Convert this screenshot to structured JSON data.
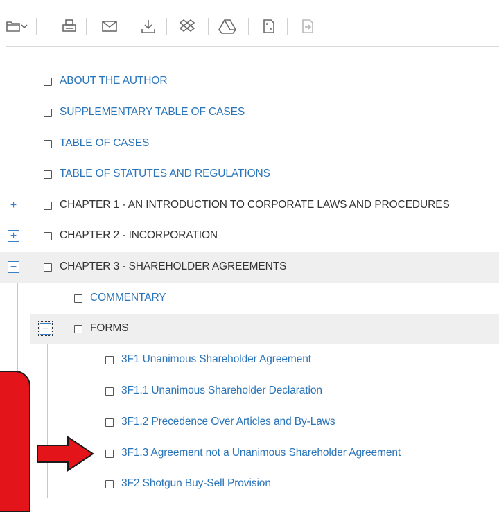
{
  "toolbar": {
    "icons": [
      "folder-icon",
      "chevron-down-icon",
      "print-icon",
      "email-icon",
      "download-icon",
      "dropbox-icon",
      "google-drive-icon",
      "save-document-icon",
      "export-icon"
    ]
  },
  "tree": {
    "items": [
      {
        "label": "ABOUT THE AUTHOR",
        "style": "link"
      },
      {
        "label": "SUPPLEMENTARY TABLE OF CASES",
        "style": "link"
      },
      {
        "label": "TABLE OF CASES",
        "style": "link"
      },
      {
        "label": "TABLE OF STATUTES AND REGULATIONS",
        "style": "link"
      },
      {
        "label": "CHAPTER 1 - AN INTRODUCTION TO CORPORATE LAWS AND PROCEDURES",
        "style": "plain",
        "toggle": "+"
      },
      {
        "label": "CHAPTER 2 - INCORPORATION",
        "style": "plain",
        "toggle": "+"
      },
      {
        "label": "CHAPTER 3 - SHAREHOLDER AGREEMENTS",
        "style": "plain",
        "toggle": "−"
      },
      {
        "label": "COMMENTARY",
        "style": "link"
      },
      {
        "label": "FORMS",
        "style": "plain",
        "toggle": "−"
      },
      {
        "label": "3F1 Unanimous Shareholder Agreement",
        "style": "link"
      },
      {
        "label": "3F1.1 Unanimous Shareholder Declaration",
        "style": "link"
      },
      {
        "label": "3F1.2 Precedence Over Articles and By-Laws",
        "style": "link"
      },
      {
        "label": "3F1.3 Agreement not a Unanimous Shareholder Agreement",
        "style": "link"
      },
      {
        "label": "3F2 Shotgun Buy-Sell Provision",
        "style": "link"
      }
    ]
  },
  "colors": {
    "link": "#2a74b9",
    "plain": "#333333",
    "highlight": "#efefef",
    "callout": "#e3151a"
  }
}
